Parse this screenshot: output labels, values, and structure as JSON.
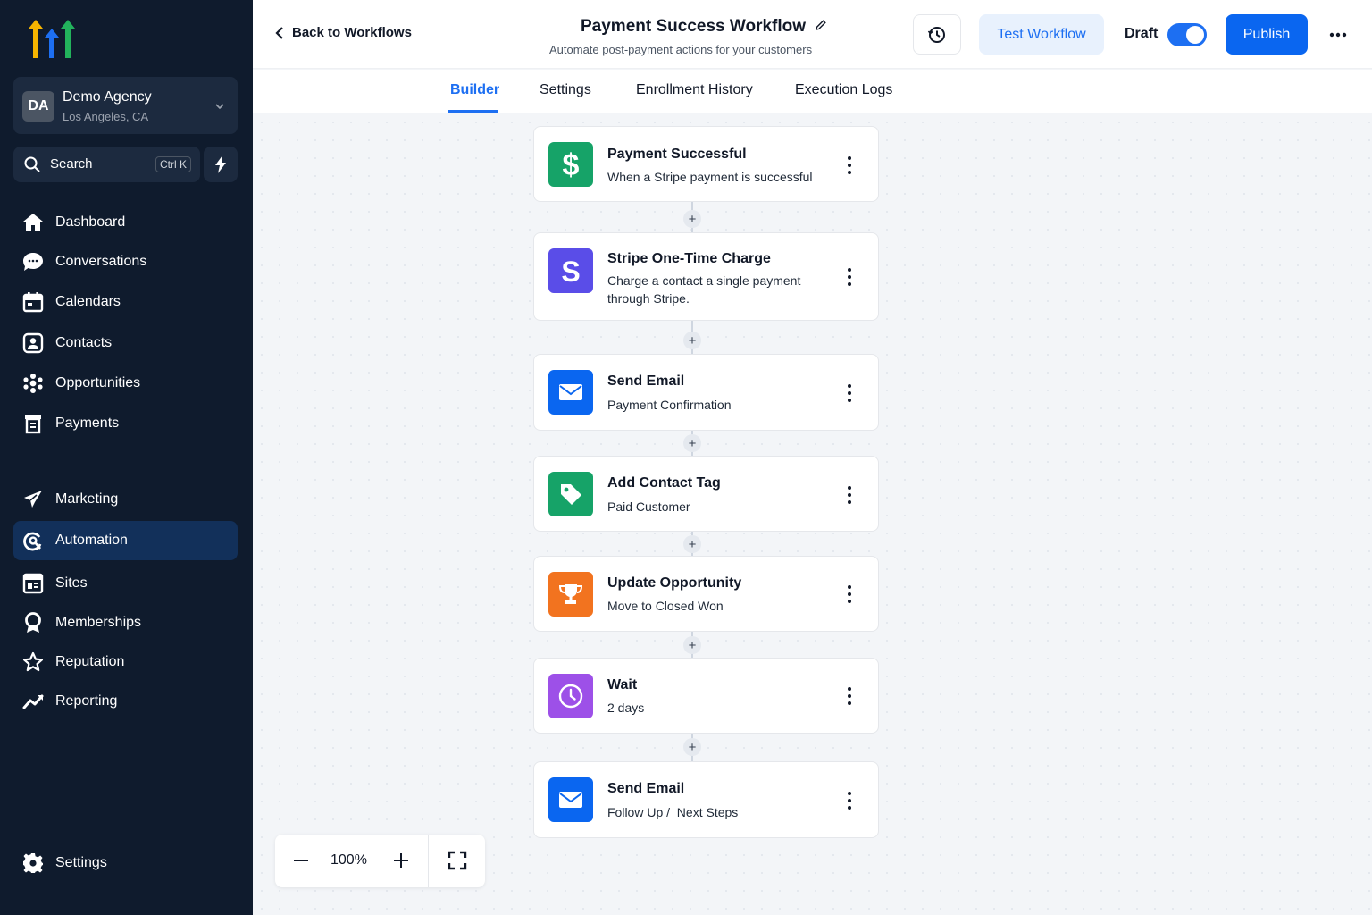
{
  "sidebar": {
    "account": {
      "initials": "DA",
      "name": "Demo Agency",
      "location": "Los Angeles, CA"
    },
    "search": {
      "label": "Search",
      "shortcut": "Ctrl K"
    },
    "items": [
      {
        "label": "Dashboard",
        "icon": "home-icon"
      },
      {
        "label": "Conversations",
        "icon": "chat-icon"
      },
      {
        "label": "Calendars",
        "icon": "calendar-icon"
      },
      {
        "label": "Contacts",
        "icon": "contact-icon"
      },
      {
        "label": "Opportunities",
        "icon": "opportunities-icon"
      },
      {
        "label": "Payments",
        "icon": "receipt-icon"
      },
      {
        "label": "Marketing",
        "icon": "send-icon"
      },
      {
        "label": "Automation",
        "icon": "automation-icon",
        "active": true
      },
      {
        "label": "Sites",
        "icon": "sites-icon"
      },
      {
        "label": "Memberships",
        "icon": "badge-icon"
      },
      {
        "label": "Reputation",
        "icon": "star-icon"
      },
      {
        "label": "Reporting",
        "icon": "chart-line-icon"
      },
      {
        "label": "Settings",
        "icon": "gear-icon"
      }
    ]
  },
  "header": {
    "back_label": "Back to Workflows",
    "title": "Payment Success Workflow",
    "subtitle": "Automate post-payment actions for your customers",
    "test_label": "Test Workflow",
    "draft_label": "Draft",
    "publish_label": "Publish"
  },
  "tabs": [
    {
      "label": "Builder",
      "active": true
    },
    {
      "label": "Settings"
    },
    {
      "label": "Enrollment History"
    },
    {
      "label": "Execution Logs"
    }
  ],
  "steps": [
    {
      "title": "Payment Successful",
      "desc": "When a Stripe payment is successful",
      "icon": "dollar-icon",
      "color": "#16a368"
    },
    {
      "title": "Stripe One-Time Charge",
      "desc": "Charge a contact a single payment through Stripe.",
      "icon": "stripe-icon",
      "color": "#5a4de8"
    },
    {
      "title": "Send Email",
      "desc": "Payment Confirmation",
      "icon": "mail-icon",
      "color": "#0a66f0"
    },
    {
      "title": "Add Contact Tag",
      "desc": "Paid Customer",
      "icon": "tag-icon",
      "color": "#16a368"
    },
    {
      "title": "Update Opportunity",
      "desc": "Move to Closed Won",
      "icon": "trophy-icon",
      "color": "#f2731f"
    },
    {
      "title": "Wait",
      "desc": "2 days",
      "icon": "clock-icon",
      "color": "#9d50e8"
    },
    {
      "title": "Send Email",
      "desc": "Follow Up /  Next Steps",
      "icon": "mail-icon",
      "color": "#0a66f0"
    }
  ],
  "zoom": {
    "level": "100%"
  }
}
